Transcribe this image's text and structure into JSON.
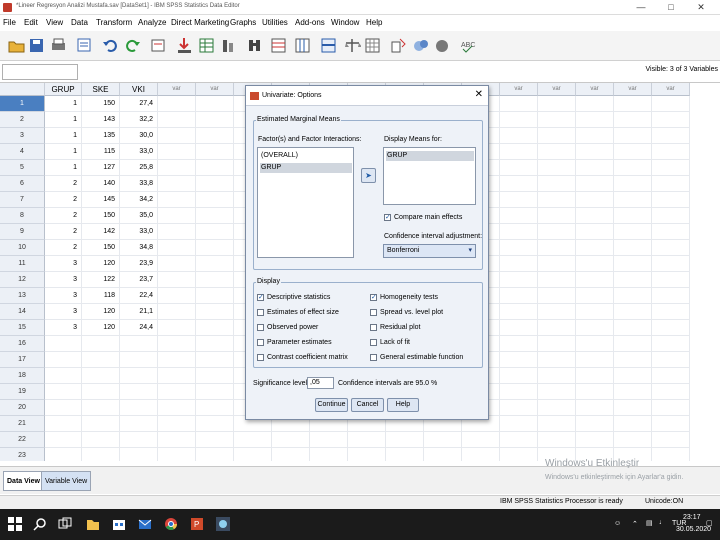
{
  "window": {
    "title": "*Lineer Regresyon Analizi Mustafa.sav [DataSet1] - IBM SPSS Statistics Data Editor",
    "min_label": "—",
    "max_label": "□",
    "close_label": "✕"
  },
  "menu": [
    "File",
    "Edit",
    "View",
    "Data",
    "Transform",
    "Analyze",
    "Direct Marketing",
    "Graphs",
    "Utilities",
    "Add-ons",
    "Window",
    "Help"
  ],
  "editor": {
    "visible_count": "Visible: 3 of 3 Variables"
  },
  "grid": {
    "columns": [
      "GRUP",
      "SKE",
      "VKI",
      "var",
      "var",
      "var",
      "var",
      "var",
      "var",
      "var",
      "var",
      "var",
      "var",
      "var",
      "var",
      "var",
      "var"
    ],
    "row_numbers": [
      "1",
      "2",
      "3",
      "4",
      "5",
      "6",
      "7",
      "8",
      "9",
      "10",
      "11",
      "12",
      "13",
      "14",
      "15",
      "16",
      "17",
      "18",
      "19",
      "20",
      "21",
      "22",
      "23"
    ],
    "selected_row": 0,
    "rows": [
      [
        "1",
        "150",
        "27,4"
      ],
      [
        "1",
        "143",
        "32,2"
      ],
      [
        "1",
        "135",
        "30,0"
      ],
      [
        "1",
        "115",
        "33,0"
      ],
      [
        "1",
        "127",
        "25,8"
      ],
      [
        "2",
        "140",
        "33,8"
      ],
      [
        "2",
        "145",
        "34,2"
      ],
      [
        "2",
        "150",
        "35,0"
      ],
      [
        "2",
        "142",
        "33,0"
      ],
      [
        "2",
        "150",
        "34,8"
      ],
      [
        "3",
        "120",
        "23,9"
      ],
      [
        "3",
        "122",
        "23,7"
      ],
      [
        "3",
        "118",
        "22,4"
      ],
      [
        "3",
        "120",
        "21,1"
      ],
      [
        "3",
        "120",
        "24,4"
      ]
    ]
  },
  "tabs": {
    "data_view": "Data View",
    "variable_view": "Variable View"
  },
  "status": {
    "processor": "IBM SPSS Statistics Processor is ready",
    "unicode": "Unicode:ON",
    "activate_title": "Windows'u Etkinleştir",
    "activate_sub": "Windows'u etkinleştirmek için Ayarlar'a gidin."
  },
  "taskbar": {
    "lang": "TUR",
    "time": "23:17",
    "date": "30.05.2020"
  },
  "dialog": {
    "title": "Univariate: Options",
    "close_label": "✕",
    "emm_group": "Estimated Marginal Means",
    "factors_label": "Factor(s) and Factor Interactions:",
    "factors": [
      "(OVERALL)",
      "GRUP"
    ],
    "display_means_label": "Display Means for:",
    "display_means": [
      "GRUP"
    ],
    "compare_main_effects": "Compare main effects",
    "ci_adjust_label": "Confidence interval adjustment:",
    "ci_adjust_value": "Bonferroni",
    "display_group": "Display",
    "options_left": [
      {
        "label": "Descriptive statistics",
        "checked": true
      },
      {
        "label": "Estimates of effect size",
        "checked": false
      },
      {
        "label": "Observed power",
        "checked": false
      },
      {
        "label": "Parameter estimates",
        "checked": false
      },
      {
        "label": "Contrast coefficient matrix",
        "checked": false
      }
    ],
    "options_right": [
      {
        "label": "Homogeneity tests",
        "checked": true
      },
      {
        "label": "Spread vs. level plot",
        "checked": false
      },
      {
        "label": "Residual plot",
        "checked": false
      },
      {
        "label": "Lack of fit",
        "checked": false
      },
      {
        "label": "General estimable function",
        "checked": false
      }
    ],
    "significance_label": "Significance level:",
    "significance_value": ",05",
    "ci_text": "Confidence intervals are 95.0 %",
    "continue": "Continue",
    "cancel": "Cancel",
    "help": "Help"
  },
  "colors": {
    "accent": "#4a7fc1",
    "dialog_bg": "#eef2f8",
    "taskbar": "#1b1b1b"
  }
}
